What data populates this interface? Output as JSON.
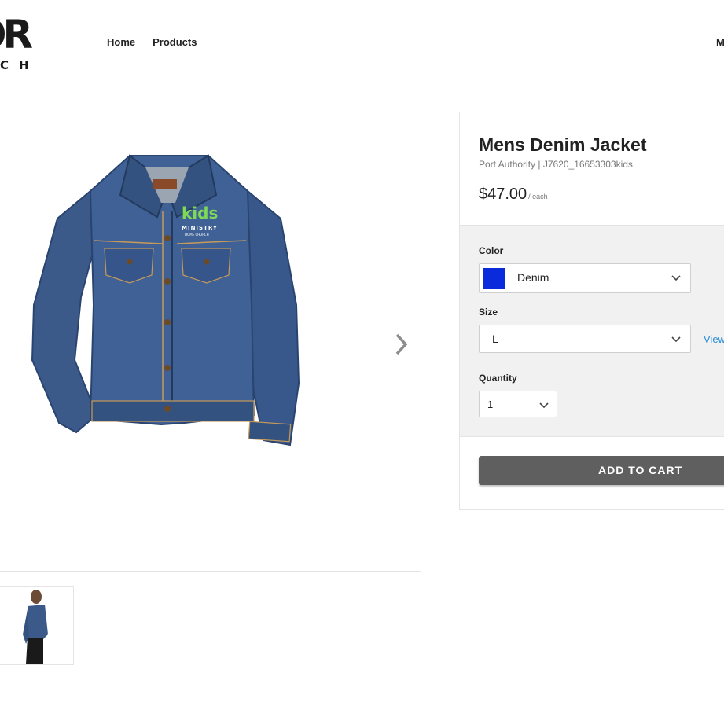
{
  "header": {
    "logo_main": "OR",
    "logo_sub": "CH",
    "nav": [
      "Home",
      "Products"
    ],
    "nav_right": "M"
  },
  "gallery": {
    "next_icon": "chevron-right-icon",
    "jacket_logo": {
      "line1": "kids",
      "line2": "MINISTRY",
      "line3": "DOME CHURCH"
    }
  },
  "product": {
    "title": "Mens Denim Jacket",
    "sku": "Port Authority | J7620_16653303kids",
    "price": "$47.00",
    "price_unit": "/ each"
  },
  "options": {
    "color_label": "Color",
    "color_value": "Denim",
    "color_swatch": "#0a2bdb",
    "size_label": "Size",
    "size_value": "L",
    "view_link": "View",
    "quantity_label": "Quantity",
    "quantity_value": "1"
  },
  "cart_button": "ADD TO CART"
}
